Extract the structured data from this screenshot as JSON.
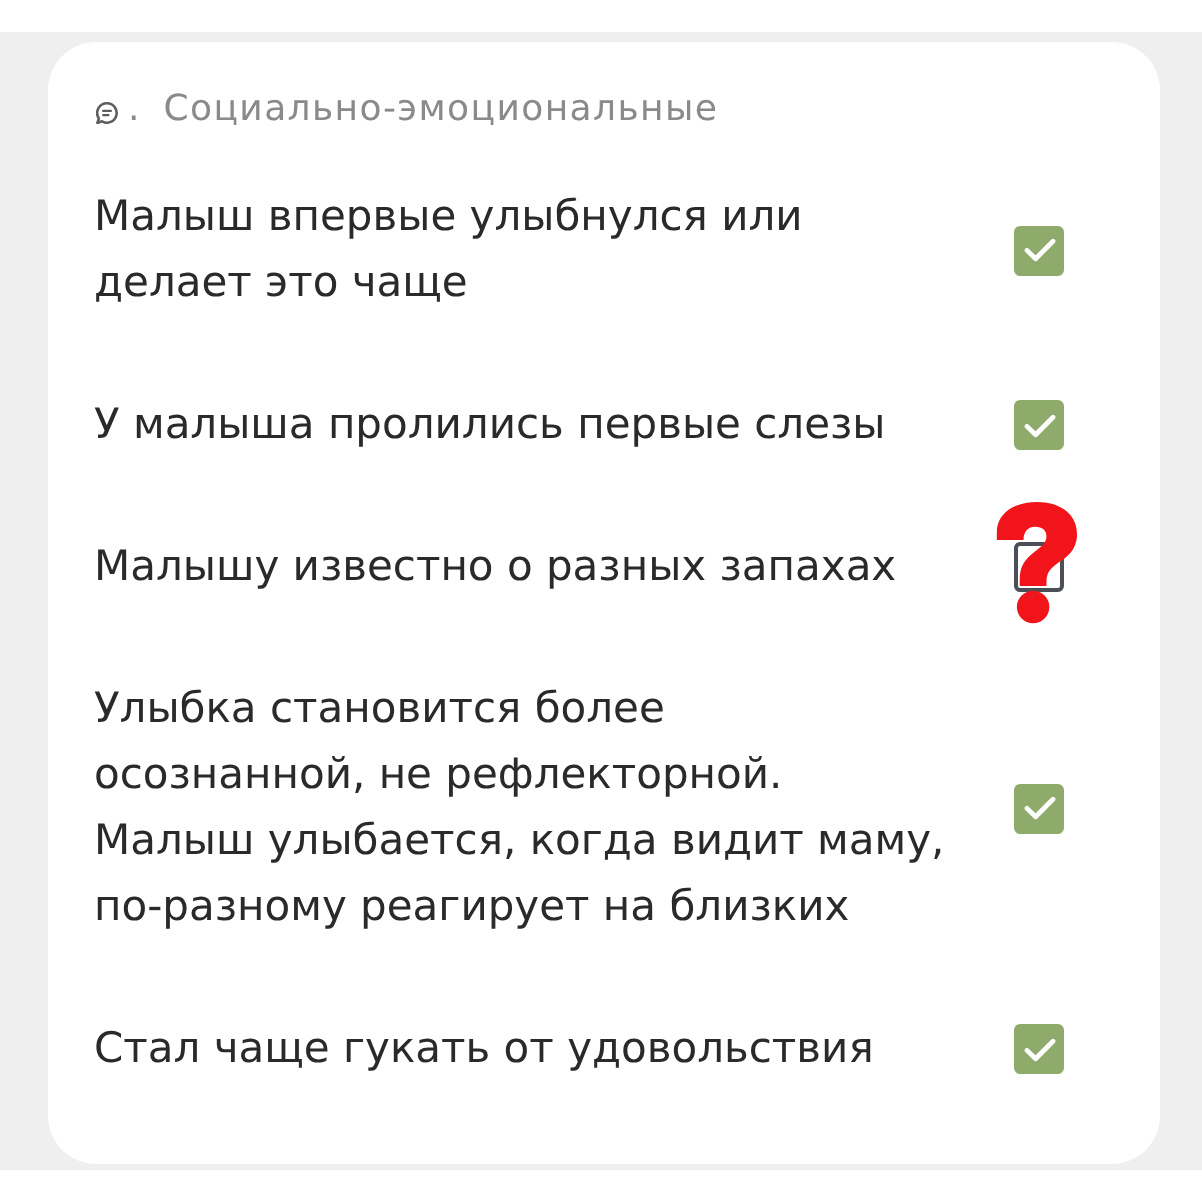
{
  "header": {
    "marker": ".",
    "title": "Социально-эмоциональные"
  },
  "items": [
    {
      "text": "Малыш впервые улыбнулся или делает это чаще",
      "checked": true,
      "flagged": false
    },
    {
      "text": "У малыша пролились первые слезы",
      "checked": true,
      "flagged": false
    },
    {
      "text": "Малышу известно о разных запахах",
      "checked": false,
      "flagged": true
    },
    {
      "text": "Улыбка становится более осознанной, не рефлекторной. Малыш улыбается, когда видит маму, по-разному реагирует на близких",
      "checked": true,
      "flagged": false
    },
    {
      "text": "Стал чаще гукать от удовольствия",
      "checked": true,
      "flagged": false
    }
  ]
}
